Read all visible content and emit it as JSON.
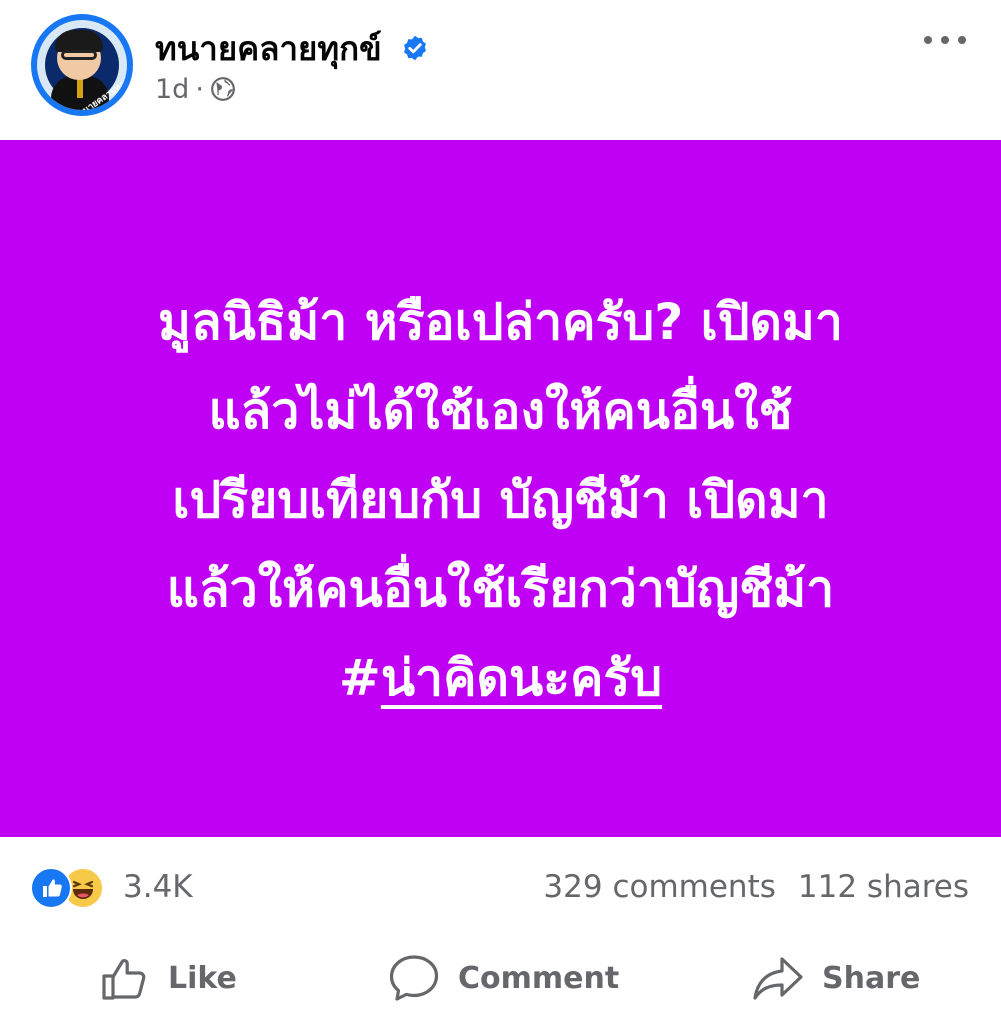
{
  "header": {
    "page_name": "ทนายคลายทุกข์",
    "time": "1d",
    "dot": "·",
    "avatar_text": "ทนายคลายทุกข์"
  },
  "post": {
    "background_color": "#c000f5",
    "lines": [
      "มูลนิธิม้า หรือเปล่าครับ? เปิดมา",
      "แล้วไม่ได้ใช้เองให้คนอื่นใช้",
      "เปรียบเทียบกับ   บัญชีม้า เปิดมา",
      "แล้วให้คนอื่นใช้เรียกว่าบัญชีม้า"
    ],
    "hashtag_symbol": "#",
    "hashtag_word": "น่าคิดนะครับ"
  },
  "stats": {
    "reaction_count": "3.4K",
    "comments": "329 comments",
    "shares": "112 shares"
  },
  "actions": {
    "like": "Like",
    "comment": "Comment",
    "share": "Share"
  },
  "colors": {
    "verified": "#1877f2",
    "like_reaction": "#1877f2",
    "haha_reaction": "#f7c948",
    "secondary_text": "#65676b"
  },
  "icons": {
    "verified": "verified-badge-icon",
    "privacy": "globe-icon",
    "more": "more-options-icon",
    "like_reaction": "like-reaction-icon",
    "haha_reaction": "haha-reaction-icon",
    "like_action": "thumbs-up-icon",
    "comment_action": "comment-bubble-icon",
    "share_action": "share-arrow-icon"
  }
}
